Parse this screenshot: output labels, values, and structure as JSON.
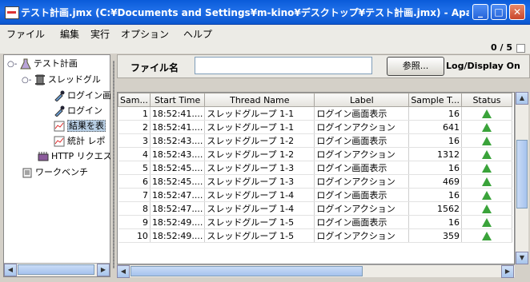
{
  "window": {
    "title": "テスト計画.jmx (C:¥Documents and Settings¥m-kino¥デスクトップ¥テスト計画.jmx) - Apa...",
    "minimize_label": "_",
    "maximize_label": "□",
    "close_label": "✕"
  },
  "menu": [
    "ファイル",
    "編集",
    "実行",
    "オプション",
    "ヘルプ"
  ],
  "counter": "0 / 5",
  "tree": [
    {
      "label": "テスト計画",
      "icon": "flask-icon"
    },
    {
      "label": "スレッドグル",
      "icon": "spool-icon"
    },
    {
      "label": "ログイン画",
      "icon": "dropper-icon"
    },
    {
      "label": "ログイン",
      "icon": "dropper-icon"
    },
    {
      "label": "結果を表",
      "icon": "chart-icon"
    },
    {
      "label": "統計 レポ",
      "icon": "chart-icon"
    },
    {
      "label": "HTTP リクエス",
      "icon": "http-config-icon"
    },
    {
      "label": "ワークベンチ",
      "icon": "clipboard-icon"
    }
  ],
  "file_panel": {
    "label": "ファイル名",
    "value": "",
    "browse": "参照...",
    "log_display": "Log/Display On"
  },
  "table": {
    "columns": [
      "Sam...",
      "Start Time",
      "Thread Name",
      "Label",
      "Sample T...",
      "Status"
    ],
    "rows": [
      [
        "1",
        "18:52:41....",
        "スレッドグループ 1-1",
        "ログイン画面表示",
        "16"
      ],
      [
        "2",
        "18:52:41....",
        "スレッドグループ 1-1",
        "ログインアクション",
        "641"
      ],
      [
        "3",
        "18:52:43....",
        "スレッドグループ 1-2",
        "ログイン画面表示",
        "16"
      ],
      [
        "4",
        "18:52:43....",
        "スレッドグループ 1-2",
        "ログインアクション",
        "1312"
      ],
      [
        "5",
        "18:52:45....",
        "スレッドグループ 1-3",
        "ログイン画面表示",
        "16"
      ],
      [
        "6",
        "18:52:45....",
        "スレッドグループ 1-3",
        "ログインアクション",
        "469"
      ],
      [
        "7",
        "18:52:47....",
        "スレッドグループ 1-4",
        "ログイン画面表示",
        "16"
      ],
      [
        "8",
        "18:52:47....",
        "スレッドグループ 1-4",
        "ログインアクション",
        "1562"
      ],
      [
        "9",
        "18:52:49....",
        "スレッドグループ 1-5",
        "ログイン画面表示",
        "16"
      ],
      [
        "10",
        "18:52:49....",
        "スレッドグループ 1-5",
        "ログインアクション",
        "359"
      ]
    ],
    "status_icon": "success-triangle-icon",
    "status_color": "#3aa33a"
  },
  "colors": {
    "titlebar": "#1e6ee8",
    "selection": "#b8cfe5"
  }
}
